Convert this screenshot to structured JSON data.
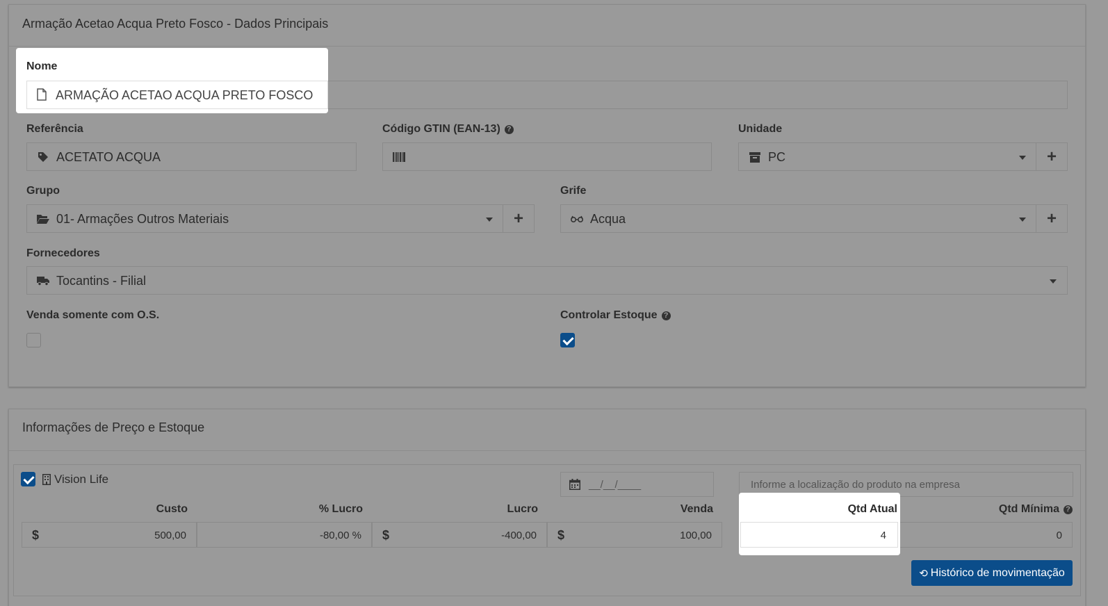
{
  "main_panel": {
    "title": "Armação Acetao Acqua Preto Fosco - Dados Principais",
    "nome": {
      "label": "Nome",
      "value": "ARMAÇÃO ACETAO ACQUA PRETO FOSCO",
      "icon": "file-icon"
    },
    "referencia": {
      "label": "Referência",
      "value": "ACETATO ACQUA",
      "icon": "tag-icon"
    },
    "gtin": {
      "label": "Código GTIN (EAN-13)",
      "value": "",
      "icon": "barcode-icon"
    },
    "unidade": {
      "label": "Unidade",
      "value": "PC",
      "icon": "archive-icon"
    },
    "grupo": {
      "label": "Grupo",
      "value": "01- Armações Outros Materiais",
      "icon": "folder-open-icon"
    },
    "grife": {
      "label": "Grife",
      "value": "Acqua",
      "icon": "glasses-icon"
    },
    "fornecedores": {
      "label": "Fornecedores",
      "value": "Tocantins - Filial",
      "icon": "truck-icon"
    },
    "venda_os": {
      "label": "Venda somente com O.S.",
      "checked": false
    },
    "controlar_estoque": {
      "label": "Controlar Estoque",
      "checked": true
    }
  },
  "price_panel": {
    "title": "Informações de Preço e Estoque",
    "store": {
      "label": "Vision Life",
      "checked": true
    },
    "date_placeholder": "__/__/____",
    "location_placeholder": "Informe a localização do produto na empresa",
    "columns": [
      "Custo",
      "% Lucro",
      "Lucro",
      "Venda",
      "Qtd Atual",
      "Qtd Mínima"
    ],
    "currency": "$",
    "values": {
      "custo": "500,00",
      "pct_lucro": "-80,00 %",
      "lucro": "-400,00",
      "venda": "100,00",
      "qtd_atual": "4",
      "qtd_minima": "0"
    },
    "history_button": "Histórico de movimentação"
  }
}
